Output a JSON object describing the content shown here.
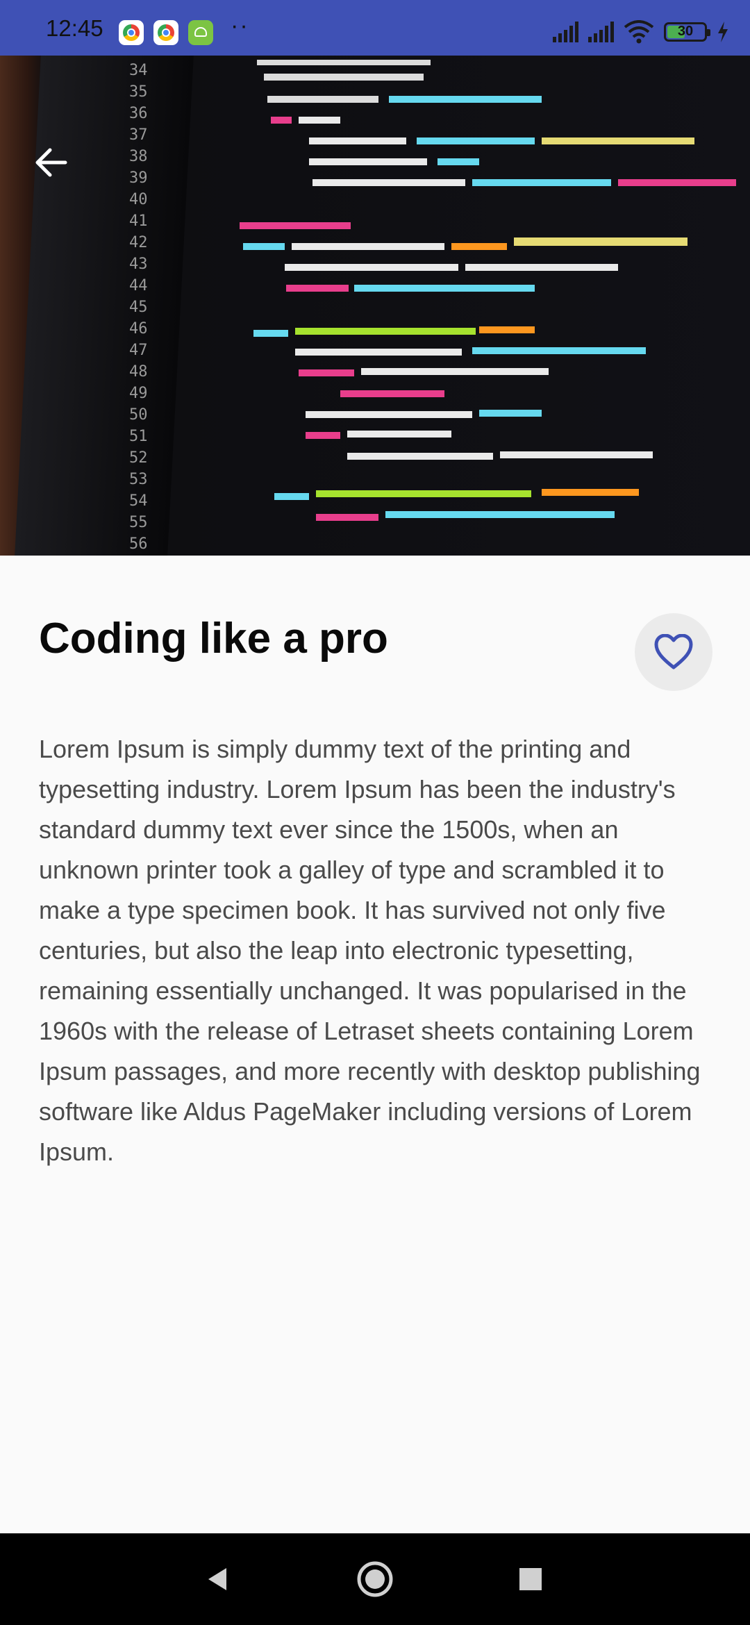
{
  "status_bar": {
    "time": "12:45",
    "overflow": "··",
    "battery": "30",
    "app_icons": [
      "chrome-icon",
      "chrome-icon",
      "android-app-icon"
    ]
  },
  "hero": {
    "line_numbers": [
      "34",
      "35",
      "36",
      "37",
      "38",
      "39",
      "40",
      "41",
      "42",
      "43",
      "44",
      "45",
      "46",
      "47",
      "48",
      "49",
      "50",
      "51",
      "52",
      "53",
      "54",
      "55",
      "56"
    ],
    "carousel": {
      "count": 2,
      "active_index": 1
    },
    "colors": {
      "dot_inactive": "#9e9e9e",
      "dot_active": "#3f51b5"
    }
  },
  "article": {
    "title": "Coding like a pro",
    "body": "Lorem Ipsum is simply dummy text of the printing and typesetting industry. Lorem Ipsum has been the industry's standard dummy text ever since the 1500s, when an unknown printer took a galley of type and scrambled it to make a type specimen book. It has survived not only five centuries, but also the leap into electronic typesetting, remaining essentially unchanged. It was popularised in the 1960s with the release of Letraset sheets containing Lorem Ipsum passages, and more recently with desktop publishing software like Aldus PageMaker including versions of Lorem Ipsum.",
    "favorite_icon": "heart-outline-icon"
  },
  "colors": {
    "accent": "#3f51b5",
    "text": "#4a4a4a",
    "title": "#0a0a0a"
  }
}
